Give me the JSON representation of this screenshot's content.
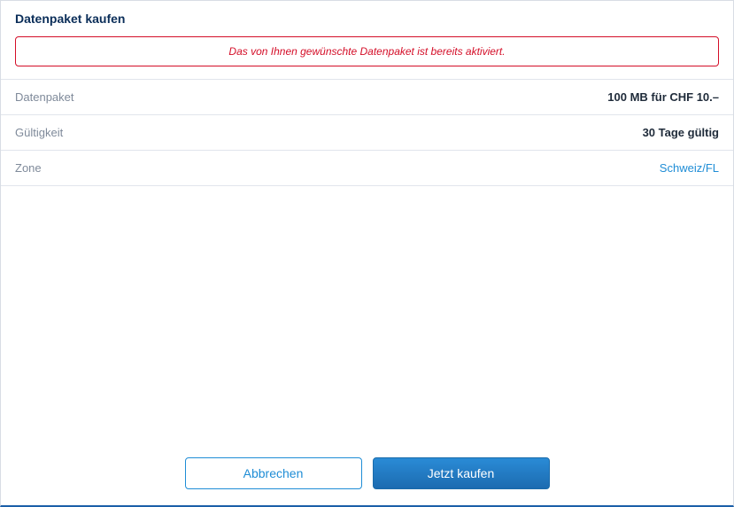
{
  "title": "Datenpaket kaufen",
  "alert": {
    "message": "Das von Ihnen gewünschte Datenpaket ist bereits aktiviert."
  },
  "rows": {
    "datapackage": {
      "label": "Datenpaket",
      "value": "100 MB für CHF 10.–"
    },
    "validity": {
      "label": "Gültigkeit",
      "value": "30 Tage gültig"
    },
    "zone": {
      "label": "Zone",
      "value": "Schweiz/FL"
    }
  },
  "buttons": {
    "cancel": "Abbrechen",
    "buy": "Jetzt kaufen"
  }
}
